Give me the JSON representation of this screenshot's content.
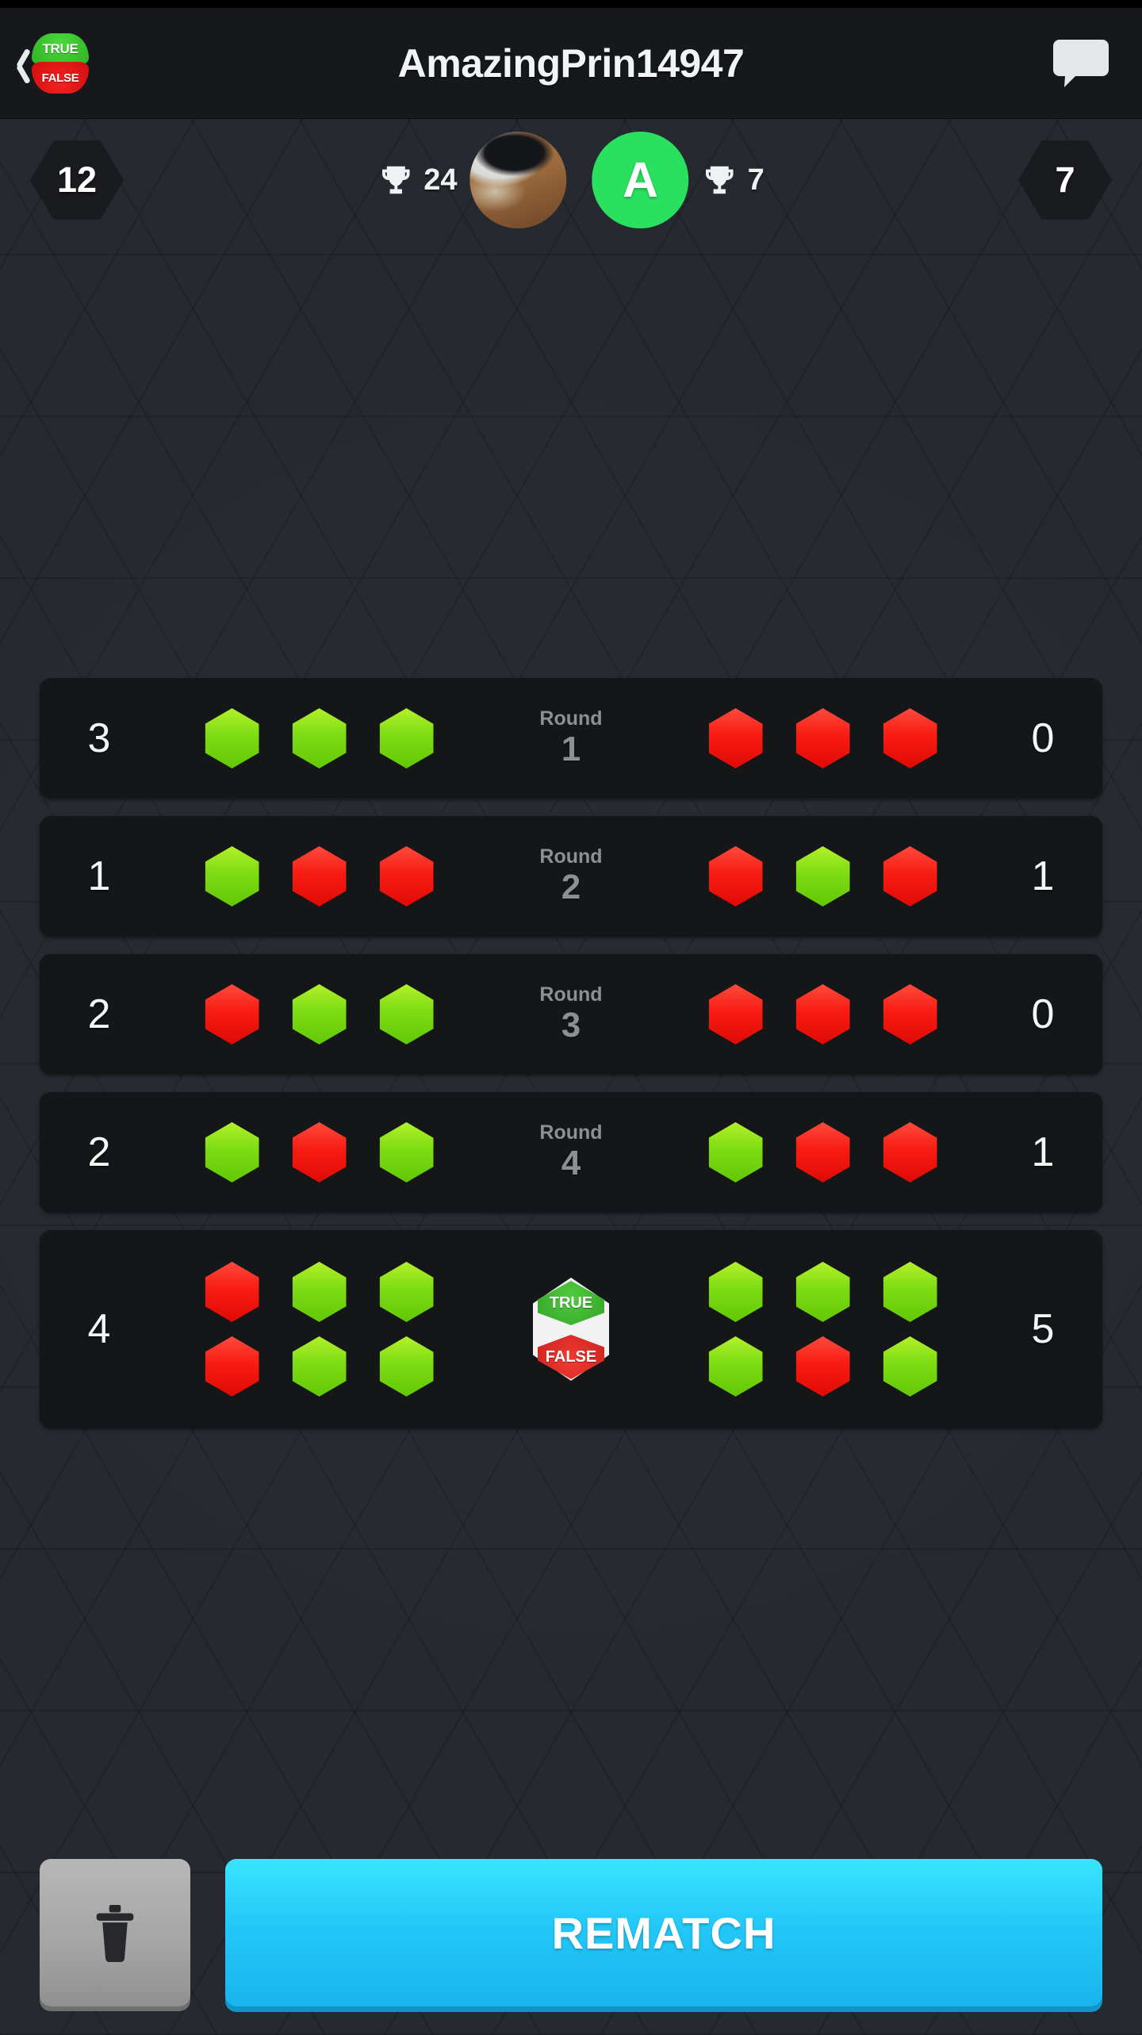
{
  "header": {
    "title": "AmazingPrin14947",
    "back_icon": "chevron-left-icon",
    "chat_icon": "chat-bubble-icon",
    "logo_true": "TRUE",
    "logo_false": "FALSE"
  },
  "player_bar": {
    "left_badge": "12",
    "right_badge": "7",
    "left_player": {
      "trophy_icon": "trophy-icon",
      "trophies": "24",
      "avatar_type": "photo"
    },
    "right_player": {
      "trophy_icon": "trophy-icon",
      "trophies": "7",
      "avatar_type": "letter",
      "avatar_letter": "A",
      "avatar_color": "#2ae05f"
    }
  },
  "rounds": [
    {
      "label": "Round",
      "number": "1",
      "left_score": "3",
      "right_score": "0",
      "left_answers": [
        [
          "green",
          "green",
          "green"
        ]
      ],
      "right_answers": [
        [
          "red",
          "red",
          "red"
        ]
      ]
    },
    {
      "label": "Round",
      "number": "2",
      "left_score": "1",
      "right_score": "1",
      "left_answers": [
        [
          "green",
          "red",
          "red"
        ]
      ],
      "right_answers": [
        [
          "red",
          "green",
          "red"
        ]
      ]
    },
    {
      "label": "Round",
      "number": "3",
      "left_score": "2",
      "right_score": "0",
      "left_answers": [
        [
          "red",
          "green",
          "green"
        ]
      ],
      "right_answers": [
        [
          "red",
          "red",
          "red"
        ]
      ]
    },
    {
      "label": "Round",
      "number": "4",
      "left_score": "2",
      "right_score": "1",
      "left_answers": [
        [
          "green",
          "red",
          "green"
        ]
      ],
      "right_answers": [
        [
          "green",
          "red",
          "red"
        ]
      ]
    }
  ],
  "total_row": {
    "left_score": "4",
    "right_score": "5",
    "left_answers": [
      [
        "red",
        "green",
        "green"
      ],
      [
        "red",
        "green",
        "green"
      ]
    ],
    "right_answers": [
      [
        "green",
        "green",
        "green"
      ],
      [
        "green",
        "red",
        "green"
      ]
    ],
    "center_logo_true": "TRUE",
    "center_logo_false": "FALSE"
  },
  "bottom": {
    "delete_icon": "trash-icon",
    "rematch_label": "REMATCH"
  },
  "colors": {
    "correct": "#7ddc12",
    "wrong": "#f81c12",
    "accent": "#22c7f7",
    "avatar_green": "#2ae05f",
    "background": "#262a30",
    "card": "#141618"
  }
}
